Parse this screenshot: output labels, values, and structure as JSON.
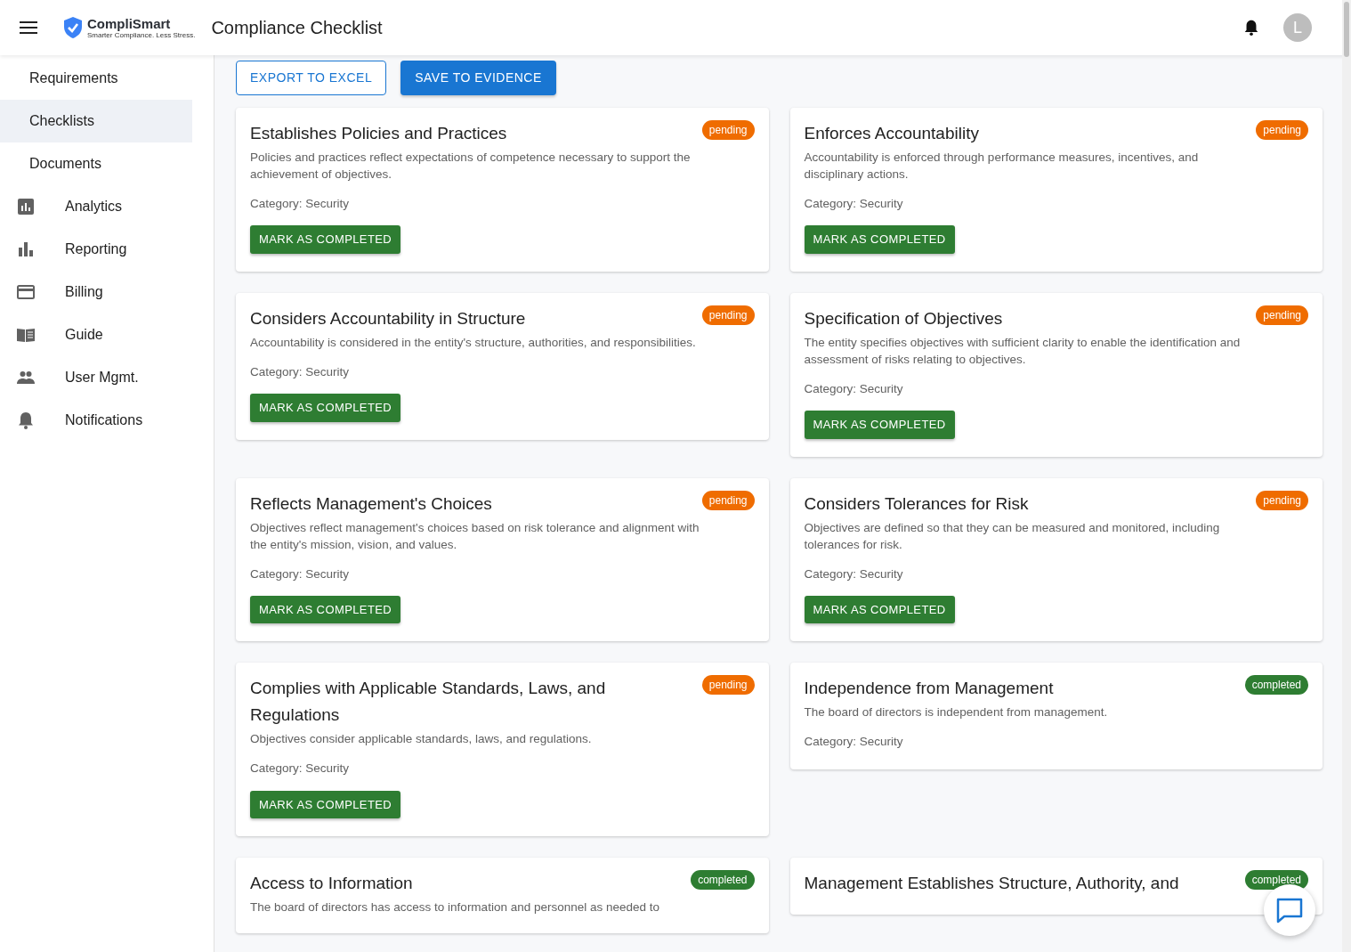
{
  "header": {
    "logo_name": "CompliSmart",
    "logo_tagline": "Smarter Compliance. Less Stress.",
    "title": "Compliance Checklist",
    "avatar_letter": "L"
  },
  "sidebar": {
    "items": [
      {
        "label": "Requirements",
        "selected": false
      },
      {
        "label": "Checklists",
        "selected": true
      },
      {
        "label": "Documents",
        "selected": false
      },
      {
        "label": "Analytics",
        "selected": false
      },
      {
        "label": "Reporting",
        "selected": false
      },
      {
        "label": "Billing",
        "selected": false
      },
      {
        "label": "Guide",
        "selected": false
      },
      {
        "label": "User Mgmt.",
        "selected": false
      },
      {
        "label": "Notifications",
        "selected": false
      }
    ]
  },
  "toolbar": {
    "export": "EXPORT TO EXCEL",
    "save": "SAVE TO EVIDENCE"
  },
  "cards": [
    {
      "title": "Establishes Policies and Practices",
      "status": "pending",
      "done": false,
      "description": "Policies and practices reflect expectations of competence necessary to support the achievement of objectives.",
      "category": "Category: Security",
      "action": "MARK AS COMPLETED"
    },
    {
      "title": "Enforces Accountability",
      "status": "pending",
      "done": false,
      "description": "Accountability is enforced through performance measures, incentives, and disciplinary actions.",
      "category": "Category: Security",
      "action": "MARK AS COMPLETED"
    },
    {
      "title": "Considers Accountability in Structure",
      "status": "pending",
      "done": false,
      "description": "Accountability is considered in the entity's structure, authorities, and responsibilities.",
      "category": "Category: Security",
      "action": "MARK AS COMPLETED"
    },
    {
      "title": "Specification of Objectives",
      "status": "pending",
      "done": false,
      "description": "The entity specifies objectives with sufficient clarity to enable the identification and assessment of risks relating to objectives.",
      "category": "Category: Security",
      "action": "MARK AS COMPLETED"
    },
    {
      "title": "Reflects Management's Choices",
      "status": "pending",
      "done": false,
      "description": "Objectives reflect management's choices based on risk tolerance and alignment with the entity's mission, vision, and values.",
      "category": "Category: Security",
      "action": "MARK AS COMPLETED"
    },
    {
      "title": "Considers Tolerances for Risk",
      "status": "pending",
      "done": false,
      "description": "Objectives are defined so that they can be measured and monitored, including tolerances for risk.",
      "category": "Category: Security",
      "action": "MARK AS COMPLETED"
    },
    {
      "title": "Complies with Applicable Standards, Laws, and Regulations",
      "status": "pending",
      "done": false,
      "description": "Objectives consider applicable standards, laws, and regulations.",
      "category": "Category: Security",
      "action": "MARK AS COMPLETED"
    },
    {
      "title": "Independence from Management",
      "status": "completed",
      "done": true,
      "description": "The board of directors is independent from management.",
      "category": "Category: Security"
    },
    {
      "title": "Access to Information",
      "status": "completed",
      "done": true,
      "description": "The board of directors has access to information and personnel as needed to"
    },
    {
      "title": "Management Establishes Structure, Authority, and",
      "status": "completed",
      "done": true
    }
  ]
}
